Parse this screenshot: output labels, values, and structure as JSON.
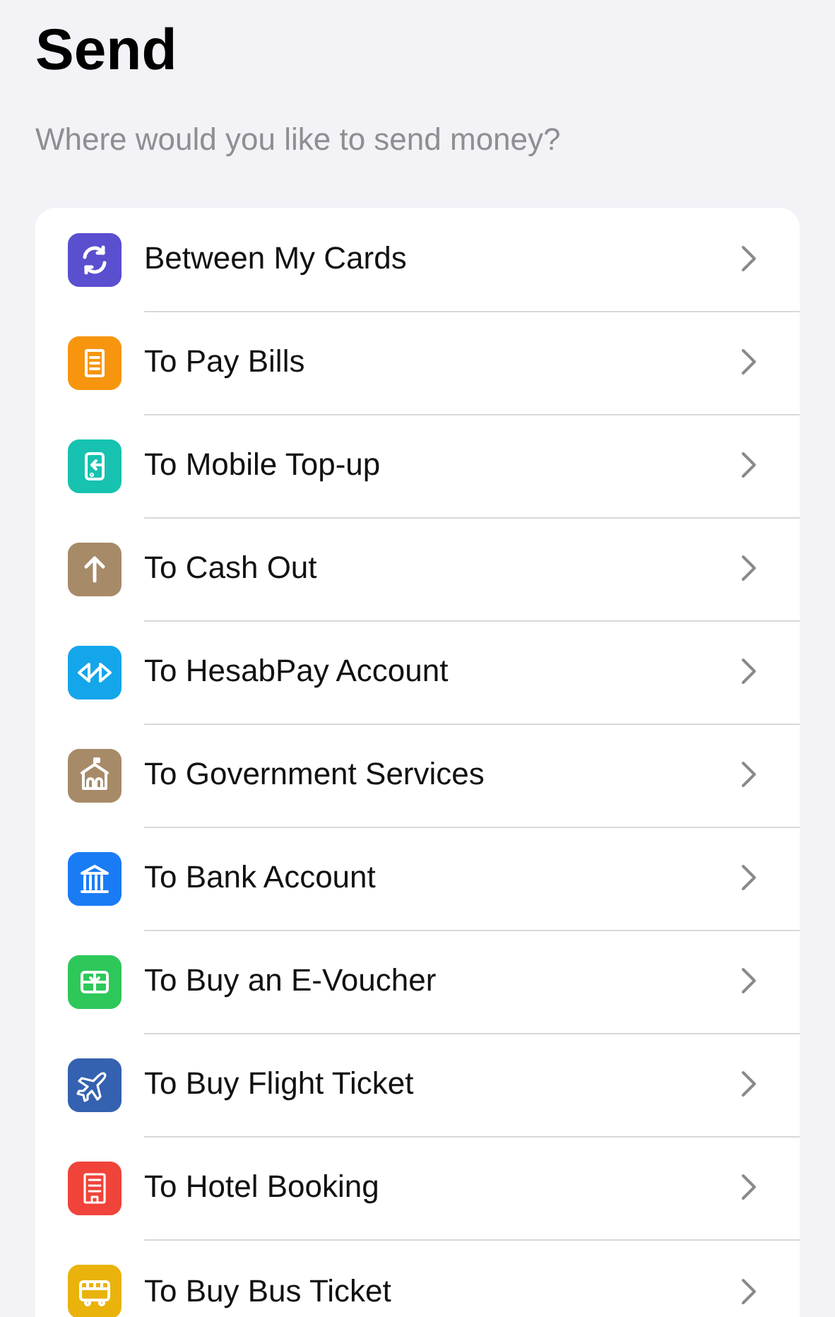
{
  "title": "Send",
  "subtitle": "Where would you like to send money?",
  "items": [
    {
      "label": "Between My Cards",
      "kind": "cycle",
      "color": "#5a4fcf"
    },
    {
      "label": "To Pay Bills",
      "kind": "bill",
      "color": "#f7950f"
    },
    {
      "label": "To Mobile Top-up",
      "kind": "phone",
      "color": "#17c2b0"
    },
    {
      "label": "To Cash Out",
      "kind": "up",
      "color": "#a78b68"
    },
    {
      "label": "To HesabPay Account",
      "kind": "hesab",
      "color": "#14a6ea"
    },
    {
      "label": "To Government Services",
      "kind": "gov",
      "color": "#a78b68"
    },
    {
      "label": "To Bank Account",
      "kind": "bank",
      "color": "#1a7cf5"
    },
    {
      "label": "To Buy an E-Voucher",
      "kind": "voucher",
      "color": "#2ec75a"
    },
    {
      "label": "To Buy Flight Ticket",
      "kind": "plane",
      "color": "#3461b0"
    },
    {
      "label": "To Hotel Booking",
      "kind": "hotel",
      "color": "#f0433a"
    },
    {
      "label": "To Buy Bus Ticket",
      "kind": "bus",
      "color": "#e9b30c"
    }
  ]
}
